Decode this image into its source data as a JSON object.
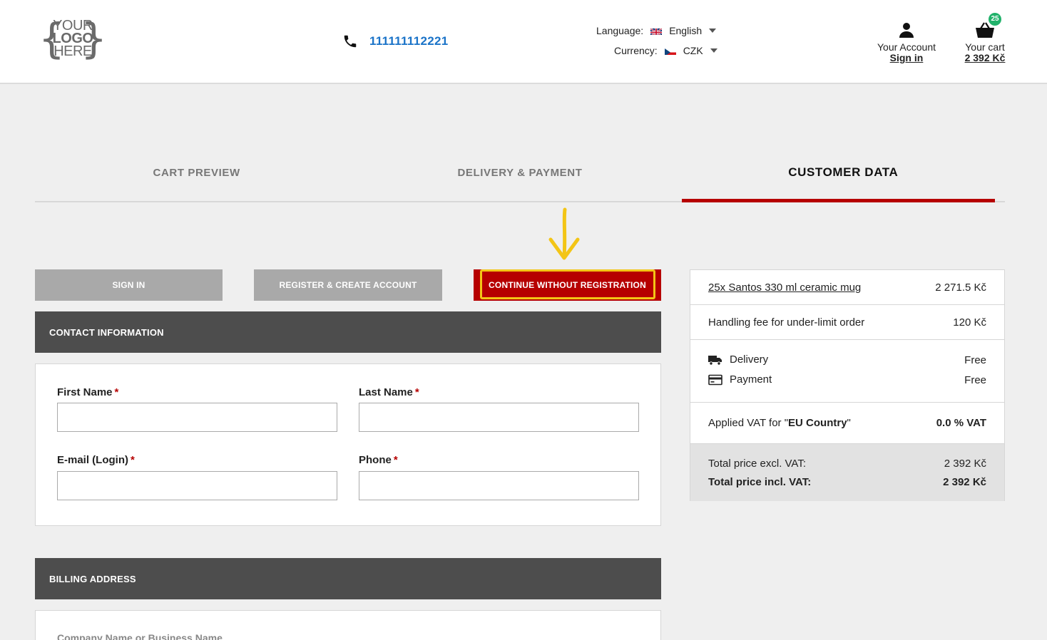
{
  "header": {
    "logo": {
      "line1": "YOUR",
      "line2": "LOGO",
      "line3": "HERE"
    },
    "phone": "111111112221",
    "language": {
      "label": "Language:",
      "value": "English",
      "flag": "uk-flag-icon"
    },
    "currency": {
      "label": "Currency:",
      "value": "CZK",
      "flag": "cz-flag-icon"
    },
    "account": {
      "label": "Your Account",
      "action": "Sign in"
    },
    "cart": {
      "label": "Your cart",
      "total": "2 392 Kč",
      "count": "25"
    }
  },
  "steps": [
    {
      "label": "CART PREVIEW",
      "active": false
    },
    {
      "label": "DELIVERY & PAYMENT",
      "active": false
    },
    {
      "label": "CUSTOMER DATA",
      "active": true
    }
  ],
  "buttons": {
    "sign_in": "SIGN IN",
    "register": "REGISTER & CREATE ACCOUNT",
    "guest": "CONTINUE WITHOUT REGISTRATION"
  },
  "contact": {
    "title": "CONTACT INFORMATION",
    "first_name": {
      "label": "First Name",
      "required": "*",
      "value": ""
    },
    "last_name": {
      "label": "Last Name",
      "required": "*",
      "value": ""
    },
    "email": {
      "label": "E-mail (Login)",
      "required": "*",
      "value": ""
    },
    "phone": {
      "label": "Phone",
      "required": "*",
      "value": ""
    }
  },
  "billing": {
    "title": "BILLING ADDRESS",
    "company_label": "Company Name or Business Name"
  },
  "summary": {
    "item": {
      "label": "25x Santos 330 ml ceramic mug",
      "price": "2 271.5 Kč"
    },
    "handling": {
      "label": "Handling fee for under-limit order",
      "price": "120 Kč"
    },
    "delivery": {
      "label": "Delivery",
      "price": "Free"
    },
    "payment": {
      "label": "Payment",
      "price": "Free"
    },
    "vat": {
      "prefix": "Applied VAT for \"",
      "country": "EU Country",
      "suffix": "\"",
      "value": "0.0 % VAT"
    },
    "total_excl": {
      "label": "Total price excl. VAT:",
      "value": "2 392 Kč"
    },
    "total_incl": {
      "label": "Total price incl. VAT:",
      "value": "2 392 Kč"
    }
  },
  "colors": {
    "accent": "#b60000",
    "link": "#1a73c8",
    "highlight": "#f3c516",
    "badge": "#21b26b"
  }
}
